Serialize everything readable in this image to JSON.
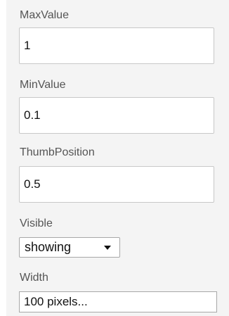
{
  "properties": {
    "max_value": {
      "label": "MaxValue",
      "value": "1"
    },
    "min_value": {
      "label": "MinValue",
      "value": "0.1"
    },
    "thumb_position": {
      "label": "ThumbPosition",
      "value": "0.5"
    },
    "visible": {
      "label": "Visible",
      "selected": "showing"
    },
    "width": {
      "label": "Width",
      "value": "100 pixels..."
    }
  }
}
